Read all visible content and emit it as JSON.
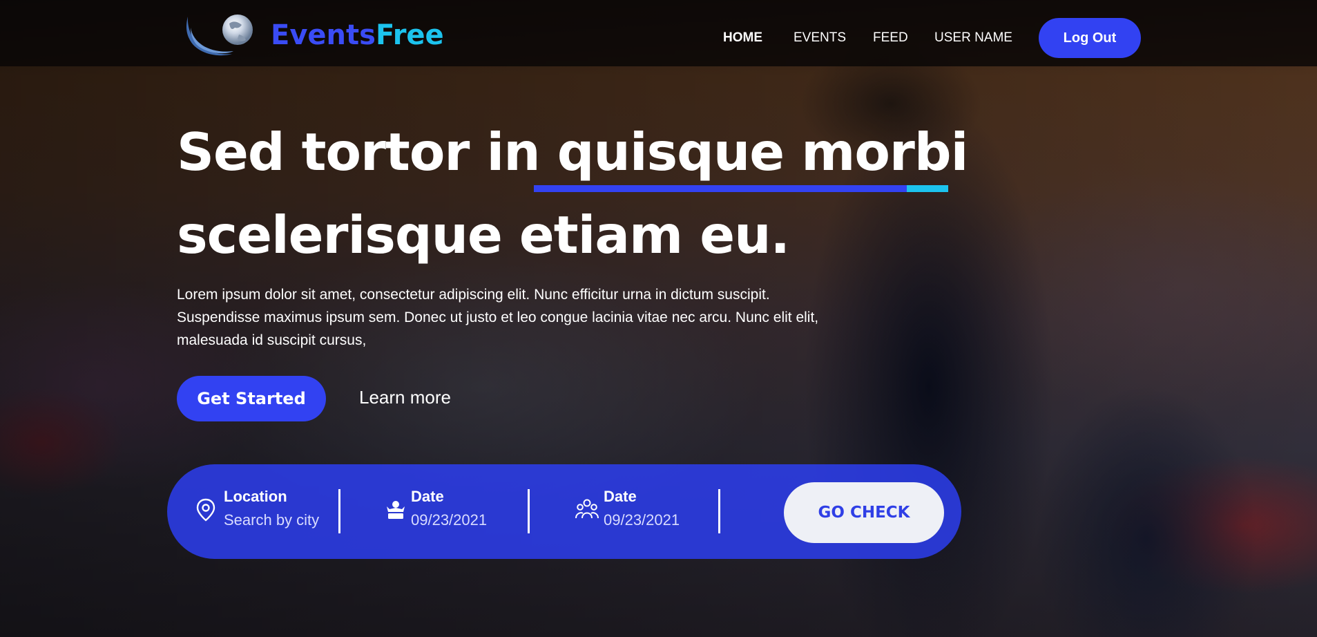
{
  "brand": {
    "part1": "Events",
    "part2": "Free",
    "color1": "#3a4cf5",
    "color2": "#1cc3ee"
  },
  "nav": {
    "items": [
      {
        "label": "HOME",
        "active": true
      },
      {
        "label": "EVENTS",
        "active": false
      },
      {
        "label": "FEED",
        "active": false
      },
      {
        "label": "USER NAME",
        "active": false
      }
    ],
    "logout_label": "Log Out"
  },
  "hero": {
    "headline_part1": "Sed tortor in ",
    "headline_highlight": "quisque morbi",
    "headline_line2": "scelerisque etiam eu.",
    "lede": "Lorem ipsum dolor sit amet, consectetur adipiscing elit. Nunc efficitur urna in dictum suscipit. Suspendisse maximus ipsum sem. Donec ut justo et leo congue lacinia vitae nec arcu. Nunc elit elit, malesuada id suscipit cursus,",
    "cta_primary": "Get Started",
    "cta_secondary": "Learn more"
  },
  "search": {
    "location": {
      "label": "Location",
      "placeholder": "Search by city",
      "icon": "location-pin-icon"
    },
    "date1": {
      "label": "Date",
      "value": "09/23/2021",
      "icon": "event-host-icon"
    },
    "date2": {
      "label": "Date",
      "value": "09/23/2021",
      "icon": "people-group-icon"
    },
    "submit_label": "GO CHECK"
  },
  "colors": {
    "accent": "#3242f2",
    "accent_cyan": "#1cc3ee",
    "search_bg": "#2c3eee"
  }
}
